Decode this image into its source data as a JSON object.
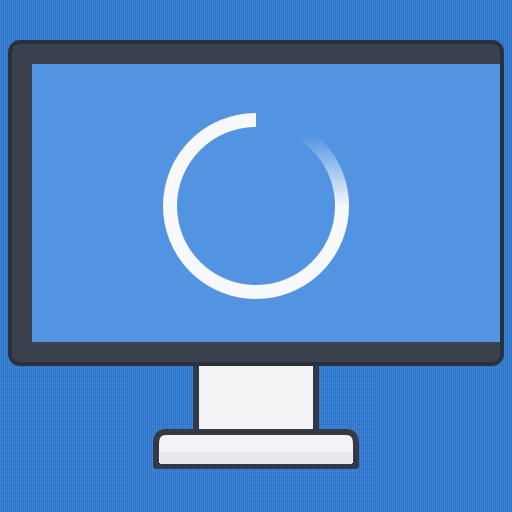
{
  "icon": {
    "name": "monitor-loading-icon",
    "parts": [
      "monitor-bezel",
      "monitor-screen",
      "loading-spinner",
      "monitor-stand",
      "monitor-base"
    ]
  },
  "colors": {
    "background": "#2a7ad8",
    "bezel": "#3a4250",
    "bezel_outline": "#2b313b",
    "screen": "#5294e2",
    "spinner": "#f7f8fa",
    "stand": "#f2f3f5",
    "stand_outline": "#333a46"
  },
  "spinner": {
    "state": "loading"
  }
}
